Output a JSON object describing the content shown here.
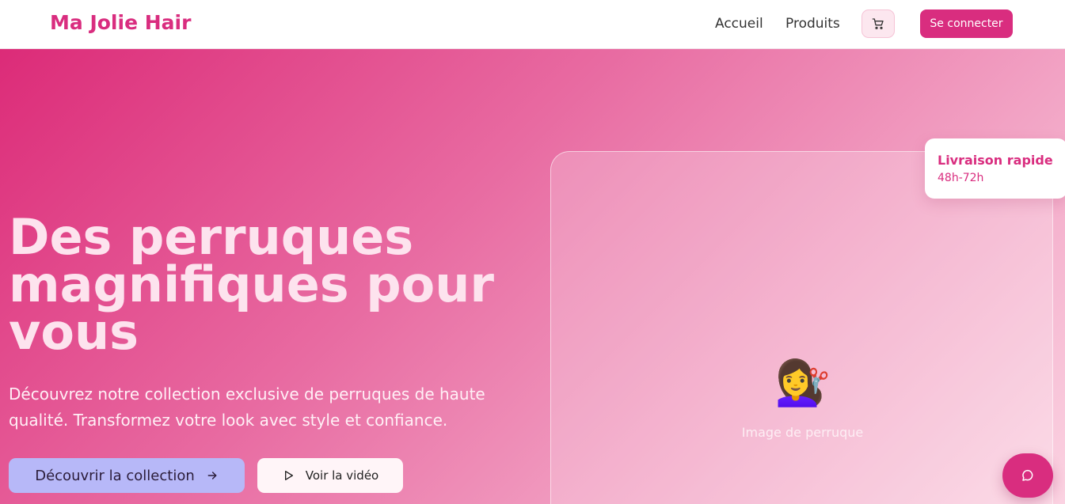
{
  "header": {
    "logo": "Ma Jolie Hair",
    "nav": {
      "accueil": "Accueil",
      "produits": "Produits"
    },
    "cart_icon": "shopping-cart-icon",
    "login_label": "Se connecter"
  },
  "hero": {
    "title": "Des perruques magnifiques pour vous",
    "subtitle": "Découvrez notre collection exclusive de perruques de haute qualité. Transformez votre look avec style et confiance.",
    "primary_cta": "Découvrir la collection",
    "primary_cta_icon": "arrow-right-icon",
    "video_cta": "Voir la vidéo",
    "video_cta_icon": "play-icon"
  },
  "image_card": {
    "emoji": "💇‍♀️",
    "caption": "Image de perruque"
  },
  "delivery": {
    "title": "Livraison rapide",
    "subtitle": "48h-72h"
  },
  "chat": {
    "icon": "chat-bubble-icon"
  },
  "colors": {
    "brand": "#d92d7f",
    "hero_gradient_start": "#dc2b78",
    "hero_gradient_end": "#fbd3e2",
    "primary_cta_bg": "#b7b8f8"
  }
}
